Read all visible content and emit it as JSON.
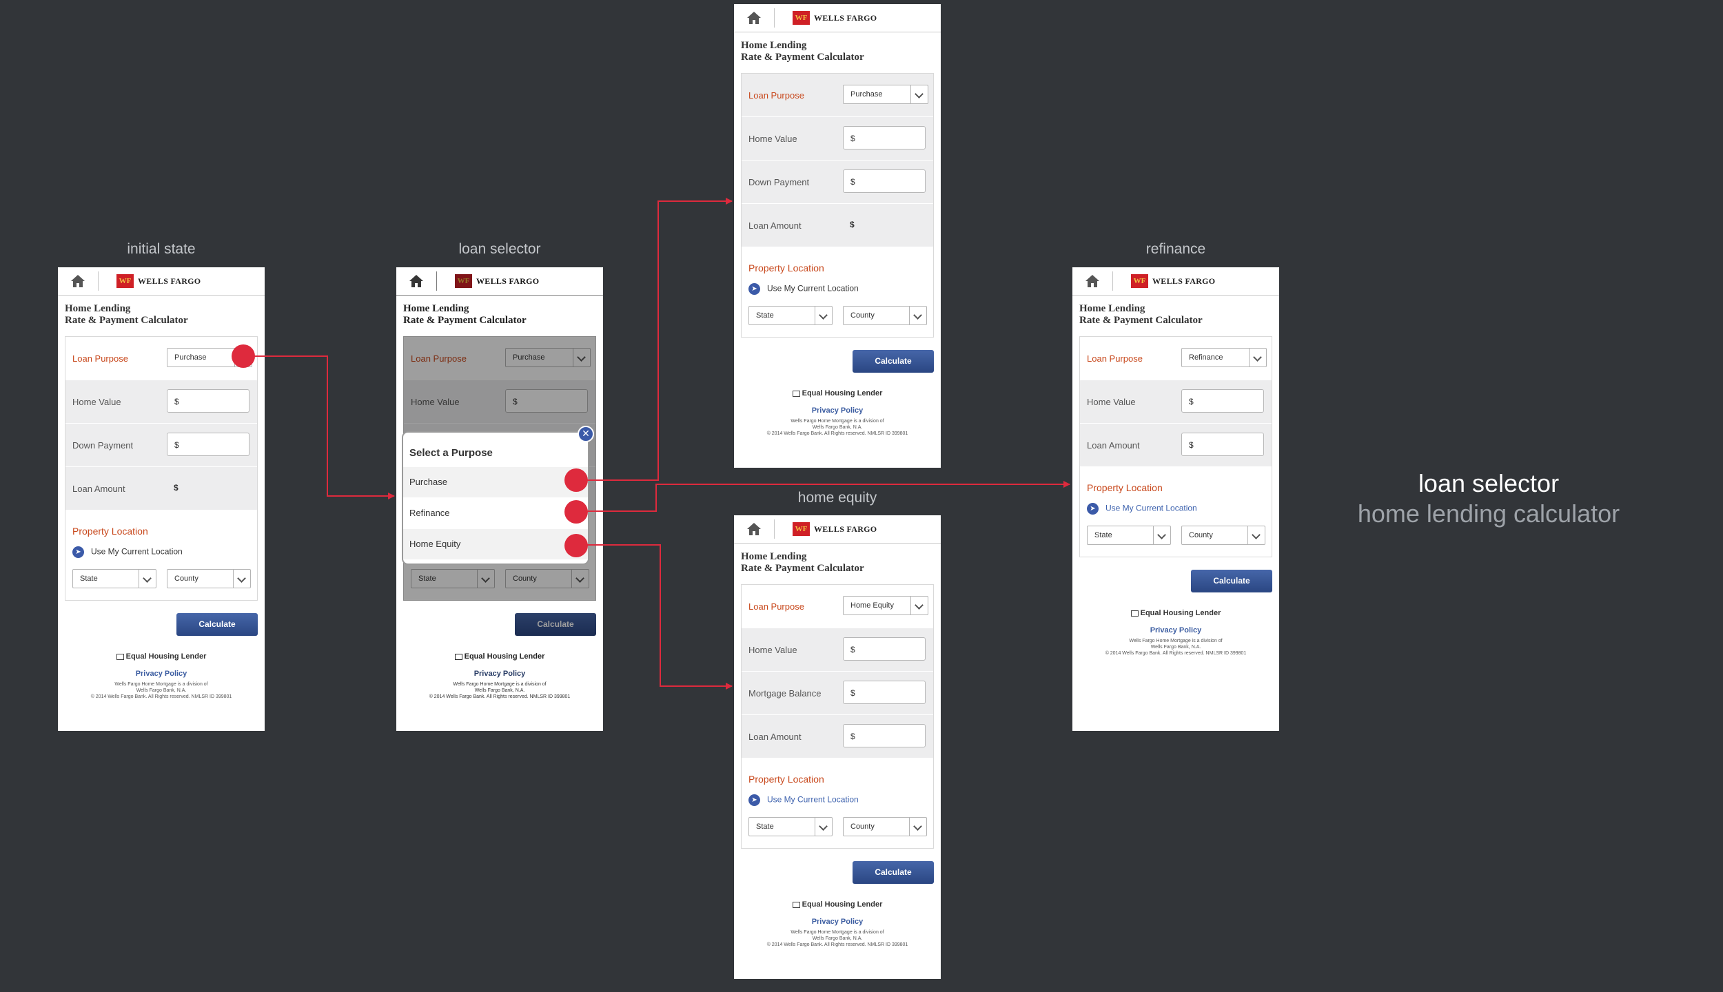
{
  "labels": {
    "initial": "initial state",
    "selector": "loan selector",
    "refinance": "refinance",
    "equity": "home equity"
  },
  "aside": {
    "line1": "loan selector",
    "line2": "home lending calculator"
  },
  "common": {
    "brand": "WELLS FARGO",
    "logo": "WF",
    "title1": "Home Lending",
    "title2": "Rate & Payment Calculator",
    "loan_purpose": "Loan Purpose",
    "home_value": "Home Value",
    "down_payment": "Down Payment",
    "loan_amount": "Loan Amount",
    "mortgage_balance": "Mortgage Balance",
    "currency": "$",
    "property_location": "Property Location",
    "use_location": "Use My Current Location",
    "state": "State",
    "county": "County",
    "calculate": "Calculate",
    "equal_housing": "Equal Housing Lender",
    "privacy": "Privacy Policy",
    "fine1": "Wells Fargo Home Mortgage is a division of",
    "fine2": "Wells Fargo Bank, N.A.",
    "fine3": "© 2014 Wells Fargo Bank. All Rights reserved. NMLSR ID 399801"
  },
  "selects": {
    "purchase": "Purchase",
    "refinance": "Refinance",
    "home_equity": "Home Equity"
  },
  "modal": {
    "title": "Select a Purpose",
    "close": "✕",
    "options": [
      "Purchase",
      "Refinance",
      "Home Equity"
    ]
  },
  "icons": {
    "home": "home-icon",
    "location": "location-arrow-icon",
    "chevron": "chevron-down-icon",
    "close": "close-icon",
    "house": "equal-housing-icon"
  },
  "colors": {
    "background": "#323539",
    "accent_red": "#de2a3d",
    "loan_label": "#c8481c",
    "button_blue": "#2a4682",
    "brand_red": "#cf2026"
  }
}
